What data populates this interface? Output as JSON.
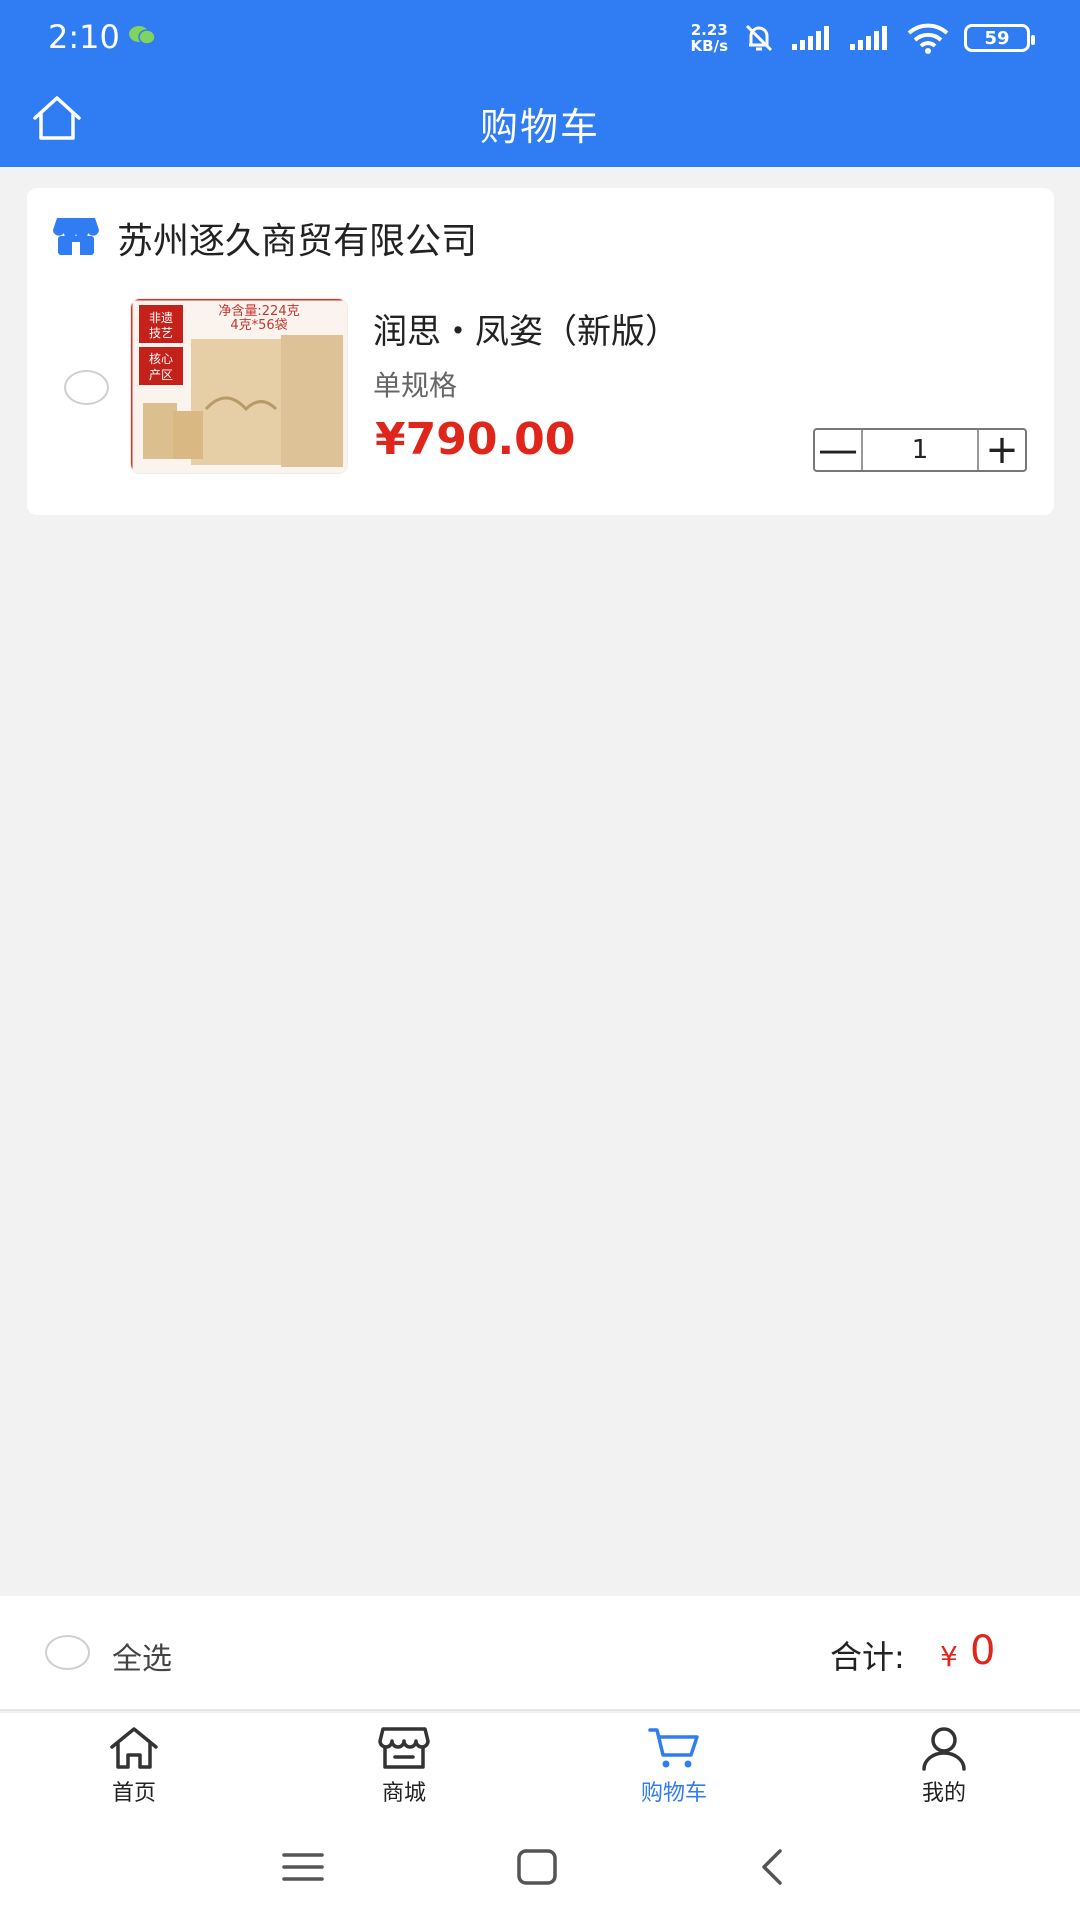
{
  "status_bar": {
    "time": "2:10",
    "net_speed_value": "2.23",
    "net_speed_unit": "KB/s",
    "battery": "59"
  },
  "header": {
    "title": "购物车"
  },
  "cart": {
    "shop_name": "苏州逐久商贸有限公司",
    "items": [
      {
        "name": "润思・凤姿（新版）",
        "spec": "单规格",
        "price": "¥790.00",
        "quantity": "1",
        "image_text": {
          "badge_1": "非遗技艺",
          "badge_2": "核心产区",
          "net_weight": "净含量:224克",
          "pack": "4克*56袋"
        }
      }
    ],
    "minus": "—",
    "plus": "+"
  },
  "summary": {
    "select_all_label": "全选",
    "total_label": "合计:",
    "total_currency": "¥",
    "total_value": "0"
  },
  "tabbar": {
    "tabs": [
      {
        "label": "首页",
        "icon": "home-icon"
      },
      {
        "label": "商城",
        "icon": "store-icon"
      },
      {
        "label": "购物车",
        "icon": "cart-icon"
      },
      {
        "label": "我的",
        "icon": "user-icon"
      }
    ],
    "active": "购物车"
  },
  "colors": {
    "accent": "#2f7cf3",
    "price": "#e0251b",
    "background": "#f2f2f2"
  }
}
